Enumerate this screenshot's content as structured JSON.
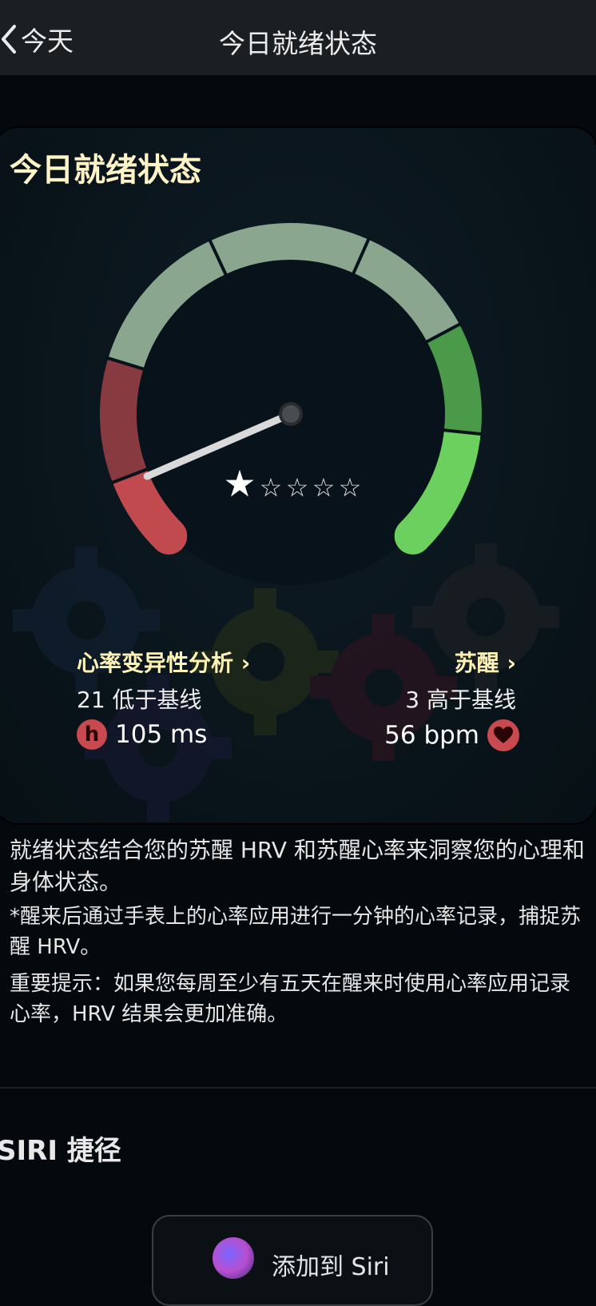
{
  "nav": {
    "back_label": "今天",
    "title": "今日就绪状态"
  },
  "card": {
    "title": "今日就绪状态",
    "rating": {
      "stars": 1,
      "max": 5,
      "filled_symbol": "★",
      "empty_symbol": "☆"
    },
    "needle_level": 0.08,
    "gauge_colors": {
      "red_dark": "#873b40",
      "red": "#c14a4e",
      "gray_green": "#8aa68f",
      "green_dark": "#4a9a4a",
      "green": "#6cd05e"
    },
    "hrv": {
      "title": "心率变异性分析 ›",
      "subtitle": "21 低于基线",
      "badge": "h",
      "value": "105 ms"
    },
    "wake": {
      "title": "苏醒 ›",
      "subtitle": "3 高于基线",
      "value": "56 bpm",
      "icon": "heart-icon"
    }
  },
  "description": {
    "p1": "就绪状态结合您的苏醒 HRV 和苏醒心率来洞察您的心理和身体状态。",
    "p2": "*醒来后通过手表上的心率应用进行一分钟的心率记录，捕捉苏醒 HRV。",
    "p3": "重要提示：如果您每周至少有五天在醒来时使用心率应用记录心率，HRV 结果会更加准确。"
  },
  "siri": {
    "section_title": "SIRI 捷径",
    "button_label": "添加到 Siri"
  }
}
